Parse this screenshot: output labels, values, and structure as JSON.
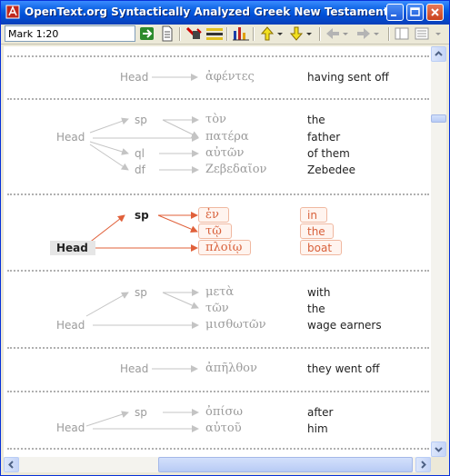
{
  "window": {
    "title": "OpenText.org Syntactically Analyzed Greek New Testament: Word Group ..."
  },
  "toolbar": {
    "reference": "Mark 1:20"
  },
  "groups": [
    {
      "head": "Head",
      "rows": [
        {
          "greek": "ἀφέντες",
          "english": "having sent off"
        }
      ]
    },
    {
      "head": "Head",
      "rows": [
        {
          "label": "sp",
          "greek": "τὸν",
          "english": "the"
        },
        {
          "label": "",
          "greek": "πατέρα",
          "english": "father"
        },
        {
          "label": "ql",
          "greek": "αὐτῶν",
          "english": "of them"
        },
        {
          "label": "df",
          "greek": "Ζεβεδαῖον",
          "english": "Zebedee"
        }
      ]
    },
    {
      "head": "Head",
      "rows": [
        {
          "label": "sp",
          "greek": "ἐν",
          "english": "in"
        },
        {
          "label": "",
          "greek": "τῷ",
          "english": "the"
        },
        {
          "label": "",
          "greek": "πλοίῳ",
          "english": "boat"
        }
      ]
    },
    {
      "head": "Head",
      "rows": [
        {
          "label": "sp",
          "greek": "μετὰ",
          "english": "with"
        },
        {
          "label": "",
          "greek": "τῶν",
          "english": "the"
        },
        {
          "label": "",
          "greek": "μισθωτῶν",
          "english": "wage earners"
        }
      ]
    },
    {
      "head": "Head",
      "rows": [
        {
          "greek": "ἀπῆλθον",
          "english": "they went off"
        }
      ]
    },
    {
      "head": "Head",
      "rows": [
        {
          "label": "sp",
          "greek": "ὀπίσω",
          "english": "after"
        },
        {
          "label": "",
          "greek": "αὐτοῦ",
          "english": "him"
        }
      ]
    }
  ],
  "colors": {
    "highlight": "#d8603a",
    "muted": "#9b9b9b",
    "titlebar": "#0a5fe0"
  }
}
